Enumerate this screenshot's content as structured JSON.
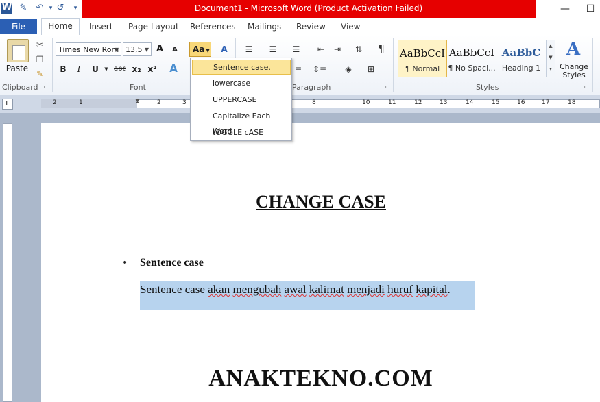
{
  "titlebar": {
    "title": "Document1  -  Microsoft Word (Product Activation Failed)",
    "minimize": "—",
    "maximize": "☐"
  },
  "qat": {
    "word_icon": "W",
    "save_icon": "✎",
    "undo_icon": "↶",
    "redo_icon": "↺",
    "more_icon": "▾"
  },
  "tabs": {
    "file": "File",
    "items": [
      "Home",
      "Insert",
      "Page Layout",
      "References",
      "Mailings",
      "Review",
      "View"
    ]
  },
  "clipboard": {
    "paste": "Paste",
    "label": "Clipboard"
  },
  "font": {
    "name": "Times New Rom",
    "size": "13,5",
    "label": "Font",
    "grow": "A",
    "shrink": "A",
    "case_button": "Aa",
    "clear": "A",
    "bold": "B",
    "italic": "I",
    "underline": "U",
    "strike": "abc",
    "sub": "x₂",
    "sup": "x²",
    "effects": "A"
  },
  "paragraph": {
    "label": "Paragraph",
    "show_marks": "¶"
  },
  "styles": {
    "label": "Styles",
    "items": [
      {
        "preview": "AaBbCcI",
        "name": "¶ Normal"
      },
      {
        "preview": "AaBbCcI",
        "name": "¶ No Spaci..."
      },
      {
        "preview": "AaBbC",
        "name": "Heading 1"
      }
    ],
    "change_styles": "Change Styles"
  },
  "change_case_menu": {
    "items": [
      "Sentence case.",
      "lowercase",
      "UPPERCASE",
      "Capitalize Each Word",
      "tOGGLE cASE"
    ]
  },
  "ruler": {
    "ticks": [
      "2",
      "1",
      "1",
      "2",
      "3",
      "8",
      "10",
      "11",
      "12",
      "13",
      "14",
      "15",
      "16",
      "17",
      "18"
    ]
  },
  "document": {
    "title": "CHANGE CASE",
    "bullet": "•",
    "heading": "Sentence case",
    "paragraph_plain": "Sentence case ",
    "paragraph_words": [
      "akan",
      "mengubah",
      "awal",
      "kalimat",
      "menjadi",
      "huruf",
      "kapital"
    ],
    "paragraph_end": ".",
    "watermark": "ANAKTEKNO.COM"
  },
  "colors": {
    "title_bar": "#e60000",
    "file_tab": "#2b5fb4",
    "selection": "#b7d3ee",
    "menu_hover": "#fbe59a"
  }
}
